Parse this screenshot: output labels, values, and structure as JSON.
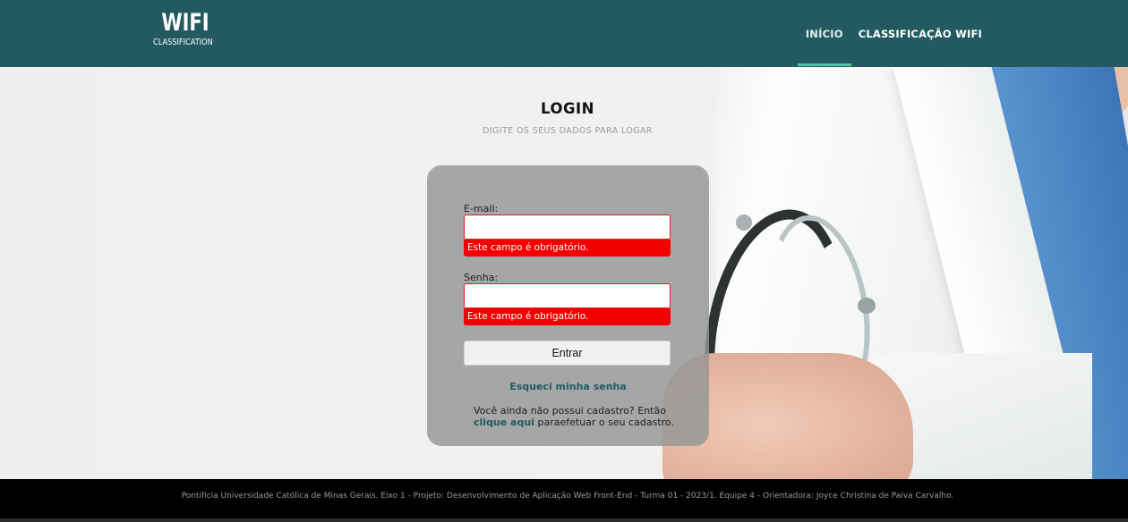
{
  "header": {
    "logo_main": "WIFI",
    "logo_sub": "CLASSIFICATION",
    "nav": [
      {
        "label": "INÍCIO",
        "active": true
      },
      {
        "label": "CLASSIFICAÇÃO WIFI",
        "active": false
      }
    ]
  },
  "login": {
    "title": "LOGIN",
    "subtitle": "DIGITE OS SEUS DADOS PARA LOGAR",
    "email_label": "E-mail:",
    "email_value": "",
    "email_error": "Este campo é obrigatório.",
    "password_label": "Senha:",
    "password_value": "",
    "password_error": "Este campo é obrigatório.",
    "submit_label": "Entrar",
    "forgot_label": "Esqueci minha senha",
    "register_prefix": "Você ainda não possui cadastro? Então",
    "register_link": "clique aqui",
    "register_suffix": "paraefetuar o seu cadastro."
  },
  "footer": {
    "text": "Pontifícia Universidade Católica de Minas Gerais. Eixo 1 - Projeto: Desenvolvimento de Aplicação Web Front-End - Turma 01 - 2023/1. Equipe 4 - Orientadora: Joyce Christina de Paiva Carvalho."
  },
  "colors": {
    "header_bg": "#235a62",
    "nav_underline": "#52c5a0",
    "error_bg": "#f40000",
    "link": "#1f5b63",
    "footer_bg": "#000000"
  }
}
